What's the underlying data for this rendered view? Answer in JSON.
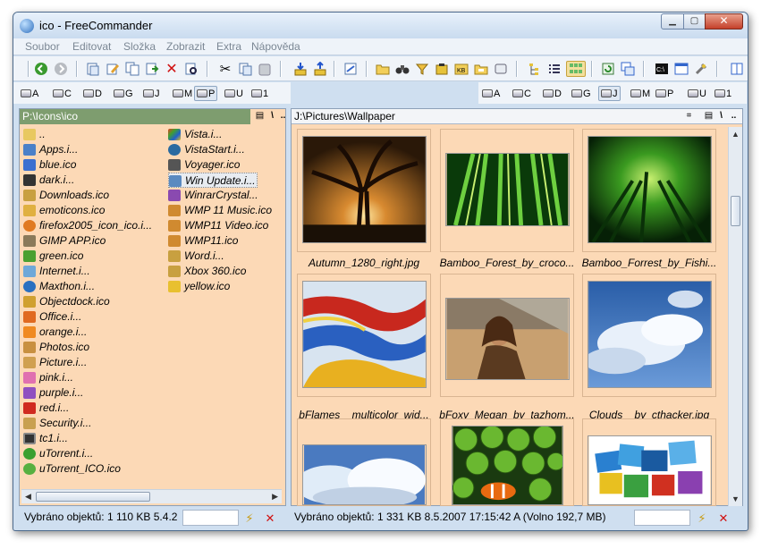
{
  "window": {
    "title": "ico - FreeCommander",
    "min_glyph": "▁",
    "max_glyph": "▢",
    "close_glyph": "✕"
  },
  "menu": [
    "Soubor",
    "Editovat",
    "Složka",
    "Zobrazit",
    "Extra",
    "Nápověda"
  ],
  "toolbar_icons": [
    "back-icon",
    "forward-icon",
    "copy-panel-icon",
    "edit-icon",
    "copy-icon",
    "move-icon",
    "delete-icon",
    "find-icon",
    "cut-icon",
    "paste-icon",
    "paste2-icon",
    "unpack-icon",
    "pack-icon",
    "compare-icon",
    "new-folder-icon",
    "binoculars-icon",
    "filter-icon",
    "zip-icon",
    "kb-icon",
    "folder-size-icon",
    "disk-icon",
    "tree-icon",
    "list-icon",
    "thumbnails-icon",
    "refresh-icon",
    "sync-icon",
    "console-icon",
    "properties-icon",
    "settings-icon",
    "panel-icon"
  ],
  "left": {
    "drives": [
      "A",
      "C",
      "D",
      "G",
      "J",
      "M",
      "P",
      "U",
      "1"
    ],
    "selected_drive": "P",
    "path": "P:\\Icons\\ico",
    "col1": [
      "..",
      "Apps.i...",
      "blue.ico",
      "dark.i...",
      "Downloads.ico",
      "emoticons.ico",
      "firefox2005_icon_ico.i...",
      "GIMP APP.ico",
      "green.ico",
      "Internet.i...",
      "Maxthon.i...",
      "Objectdock.ico",
      "Office.i...",
      "orange.i...",
      "Photos.ico",
      "Picture.i...",
      "pink.i...",
      "purple.i...",
      "red.i...",
      "Security.i...",
      "tc1.i...",
      "uTorrent.i...",
      "uTorrent_ICO.ico"
    ],
    "col2": [
      "Vista.i...",
      "VistaStart.i...",
      "Voyager.ico",
      "Win Update.i...",
      "WinrarCrystal...",
      "WMP 11 Music.ico",
      "WMP11 Video.ico",
      "WMP11.ico",
      "Word.i...",
      "Xbox 360.ico",
      "yellow.ico"
    ],
    "selected_item": "Win Update.i...",
    "status": "Vybráno objektů: 1   110 KB  5.4.2"
  },
  "right": {
    "drives": [
      "A",
      "C",
      "D",
      "G",
      "J",
      "M",
      "P",
      "U",
      "1"
    ],
    "selected_drive": "J",
    "path": "J:\\Pictures\\Wallpaper",
    "thumbs": [
      "Autumn_1280_right.jpg",
      "Bamboo_Forest_by_croco...",
      "Bamboo_Forrest_by_Fishi...",
      "bFlames__multicolor_wid...",
      "bFoxy_Megan_by_tazhom...",
      "Clouds__by_cthacker.jpg",
      "",
      "",
      ""
    ],
    "status": "Vybráno objektů: 1   331 KB  8.5.2007 17:15:42  A   (Volno 192,7 MB)"
  },
  "colors": {
    "panel_bg": "#fcd9b6",
    "left_path_bg": "#7e9d6f",
    "frame": "#cfdff0"
  }
}
